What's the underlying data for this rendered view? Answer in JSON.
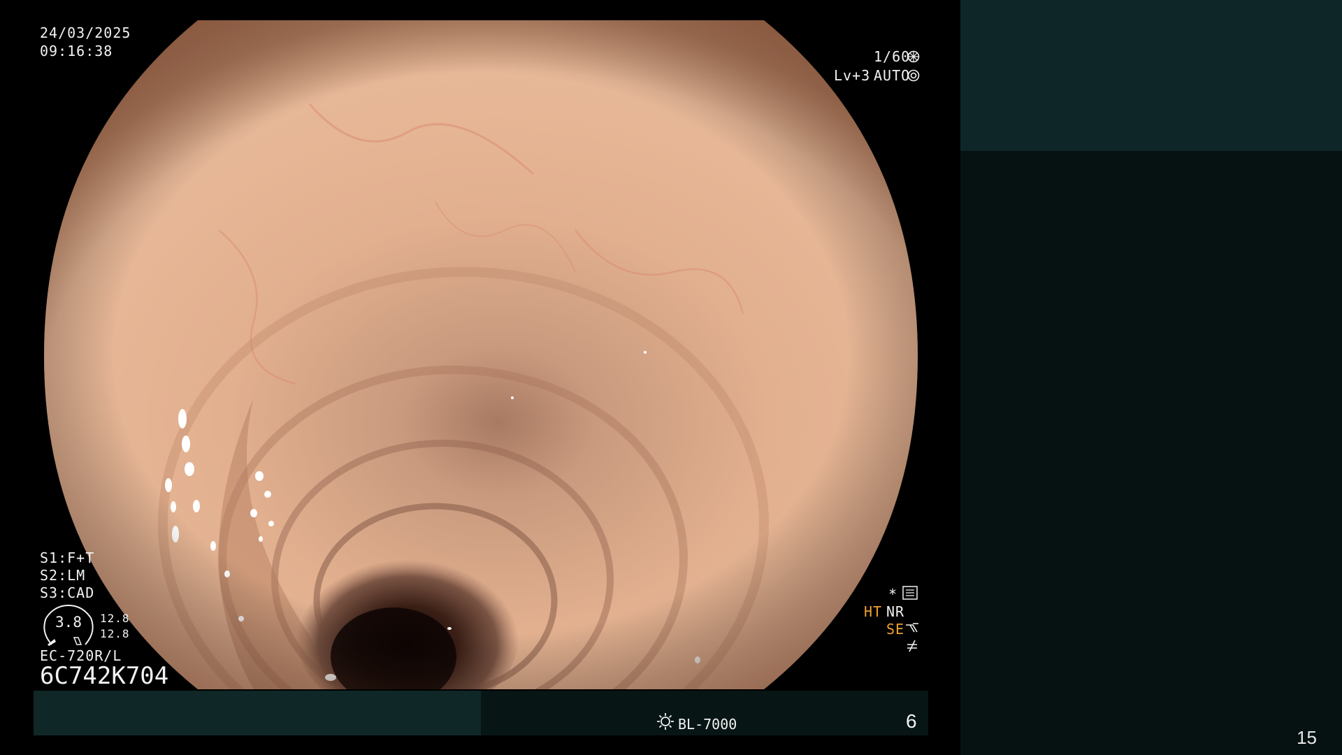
{
  "osd": {
    "date": "24/03/2025",
    "time": "09:16:38",
    "shutter": "1/60",
    "level": "Lv+3",
    "iris_mode": "AUTO",
    "s1": "S1:F+T",
    "s2": "S2:LM",
    "s3": "S3:CAD",
    "gauge_value": "3.8",
    "gauge_side_top": "12.8",
    "gauge_side_bottom": "12.8",
    "scope_model": "EC-720R/L",
    "serial": "6C742K704",
    "asterisk": "*",
    "ht": "HT",
    "nr": "NR",
    "se": "SE"
  },
  "bottom_bar": {
    "light_source": "BL-7000",
    "index": "6"
  },
  "page_number": "15",
  "icons": {
    "shutter": "aperture-icon",
    "iris": "iris-icon",
    "settings": "settings-panel-icon",
    "structure": "structure-enhance-icon",
    "freeze": "freeze-icon",
    "lamp": "lamp-icon"
  },
  "colors": {
    "osd_text": "#f2f2f2",
    "osd_accent": "#f0a030",
    "bar_dark_teal": "#0f2727",
    "side_panel_top": "#0e2628",
    "side_panel_bottom": "#051211"
  }
}
